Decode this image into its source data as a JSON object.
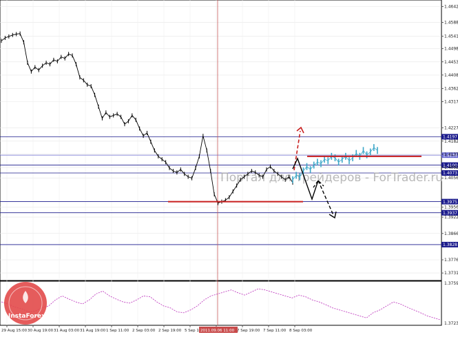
{
  "chart_data": {
    "type": "line",
    "price_axis": {
      "ticks": [
        "1.46420",
        "1.45880",
        "1.45410",
        "1.44980",
        "1.44530",
        "1.44080",
        "1.43620",
        "1.43170",
        "1.42270",
        "1.41820",
        "1.41370",
        "1.40920",
        "1.40560",
        "1.39560",
        "1.39220",
        "1.38660",
        "1.37760",
        "1.37310"
      ],
      "ylim": [
        1.371,
        1.466
      ]
    },
    "oscillator_axis": {
      "ticks": [
        "1.37591",
        "1.37239"
      ],
      "ylim": [
        0,
        100
      ]
    },
    "time_axis": {
      "labels": [
        "29 Aug 15:00",
        "30 Aug 19:00",
        "31 Aug 03:00",
        "31 Aug 19:00",
        "1 Sep 11:00",
        "2 Sep 03:00",
        "2 Sep 19:00",
        "5 Sep 11:00",
        "6 Sep 03:00",
        "7 Sep 19:00",
        "7 Sep 11:00",
        "8 Sep 03:00"
      ],
      "cursor_label": "2011.09.06 11:00"
    },
    "horizontal_levels": [
      {
        "price": 1.4197,
        "label": "1.4197",
        "color": "#1a1a8c"
      },
      {
        "price": 1.4134,
        "label": "1.4134",
        "color": "#6a6ad0"
      },
      {
        "price": 1.41,
        "label": "1.4100",
        "color": "#1a1a8c"
      },
      {
        "price": 1.4073,
        "label": "1.4073",
        "color": "#1a1a8c"
      },
      {
        "price": 1.3975,
        "label": "1.3975",
        "color": "#1a1a8c"
      },
      {
        "price": 1.3937,
        "label": "1.3937",
        "color": "#1a1a8c"
      },
      {
        "price": 1.3828,
        "label": "1.3828",
        "color": "#1a1a8c"
      }
    ],
    "resistance_line": {
      "price": 1.413,
      "color": "#c81e1e"
    },
    "support_line": {
      "price": 1.3975,
      "color": "#c81e1e"
    },
    "price_series": {
      "name": "",
      "color": "#000000",
      "values": [
        1.4525,
        1.4535,
        1.454,
        1.4545,
        1.4548,
        1.455,
        1.452,
        1.445,
        1.442,
        1.4435,
        1.4425,
        1.444,
        1.445,
        1.4445,
        1.446,
        1.4455,
        1.447,
        1.4465,
        1.448,
        1.4475,
        1.4445,
        1.44,
        1.439,
        1.4375,
        1.437,
        1.434,
        1.43,
        1.426,
        1.428,
        1.4265,
        1.427,
        1.4275,
        1.4265,
        1.424,
        1.425,
        1.427,
        1.4255,
        1.4225,
        1.42,
        1.421,
        1.418,
        1.415,
        1.413,
        1.412,
        1.411,
        1.409,
        1.408,
        1.4075,
        1.4085,
        1.407,
        1.406,
        1.4055,
        1.409,
        1.413,
        1.42,
        1.415,
        1.408,
        1.4,
        1.397,
        1.3975,
        1.398,
        1.399,
        1.401,
        1.403,
        1.405,
        1.406,
        1.407,
        1.408,
        1.4075,
        1.4065,
        1.406,
        1.4085,
        1.4095,
        1.408,
        1.407,
        1.406,
        1.405,
        1.406,
        1.404
      ]
    },
    "projection_series": {
      "name": "",
      "color": "#3aa6c8",
      "values": [
        1.405,
        1.4065,
        1.406,
        1.408,
        1.4095,
        1.4085,
        1.41,
        1.411,
        1.4105,
        1.412,
        1.4115,
        1.413,
        1.4125,
        1.411,
        1.412,
        1.413,
        1.4115,
        1.4125,
        1.414,
        1.413,
        1.415,
        1.4135,
        1.4145,
        1.416,
        1.415
      ]
    },
    "oscillator_series": {
      "name": "",
      "color": "#c040c0",
      "values": [
        55,
        50,
        42,
        38,
        30,
        32,
        40,
        45,
        60,
        70,
        62,
        55,
        50,
        60,
        75,
        82,
        70,
        62,
        55,
        52,
        60,
        70,
        68,
        55,
        45,
        40,
        30,
        28,
        35,
        45,
        60,
        70,
        75,
        80,
        85,
        78,
        72,
        80,
        88,
        85,
        80,
        75,
        70,
        65,
        72,
        68,
        60,
        55,
        48,
        40,
        35,
        30,
        25,
        20,
        15,
        28,
        35,
        45,
        55,
        50,
        42,
        35,
        28,
        20,
        15,
        10
      ]
    },
    "scenario_arrows": [
      {
        "name": "bullish-scenario",
        "color": "#c81e1e",
        "dashed": true
      },
      {
        "name": "bearish-scenario",
        "color": "#000000",
        "dashed": true
      }
    ],
    "watermark": "Портал для трейдеров - ForTrader.ru",
    "logo": "InstaForex",
    "grid": true
  }
}
